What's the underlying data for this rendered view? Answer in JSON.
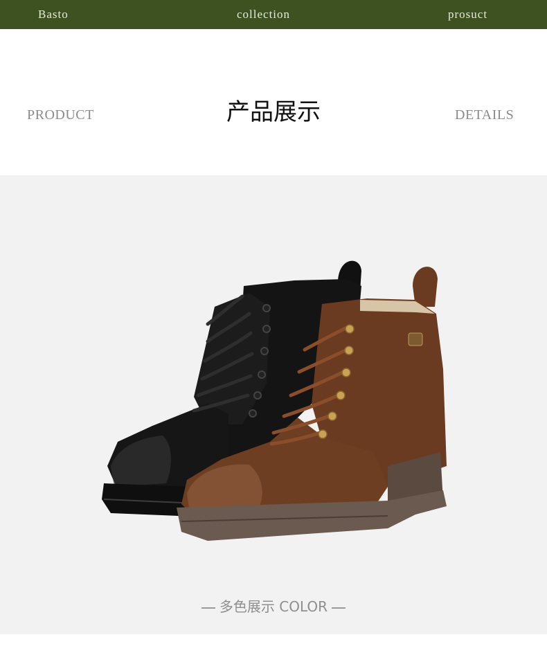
{
  "nav": {
    "left": "Basto",
    "center": "collection",
    "right": "prosuct"
  },
  "header": {
    "left_word": "PRODUCT",
    "title": "产品展示",
    "right_word": "DETAILS"
  },
  "product": {
    "caption": "多色展示 COLOR",
    "colors": {
      "black_boot": "#141414",
      "brown_boot": "#6b3b21",
      "sole_brown": "#5a4a40",
      "eyelet": "#c9a256"
    },
    "images": [
      "black-boot-image",
      "brown-boot-image"
    ]
  },
  "theme": {
    "topbar": "#3d5220",
    "panel": "#f2f2f2"
  }
}
